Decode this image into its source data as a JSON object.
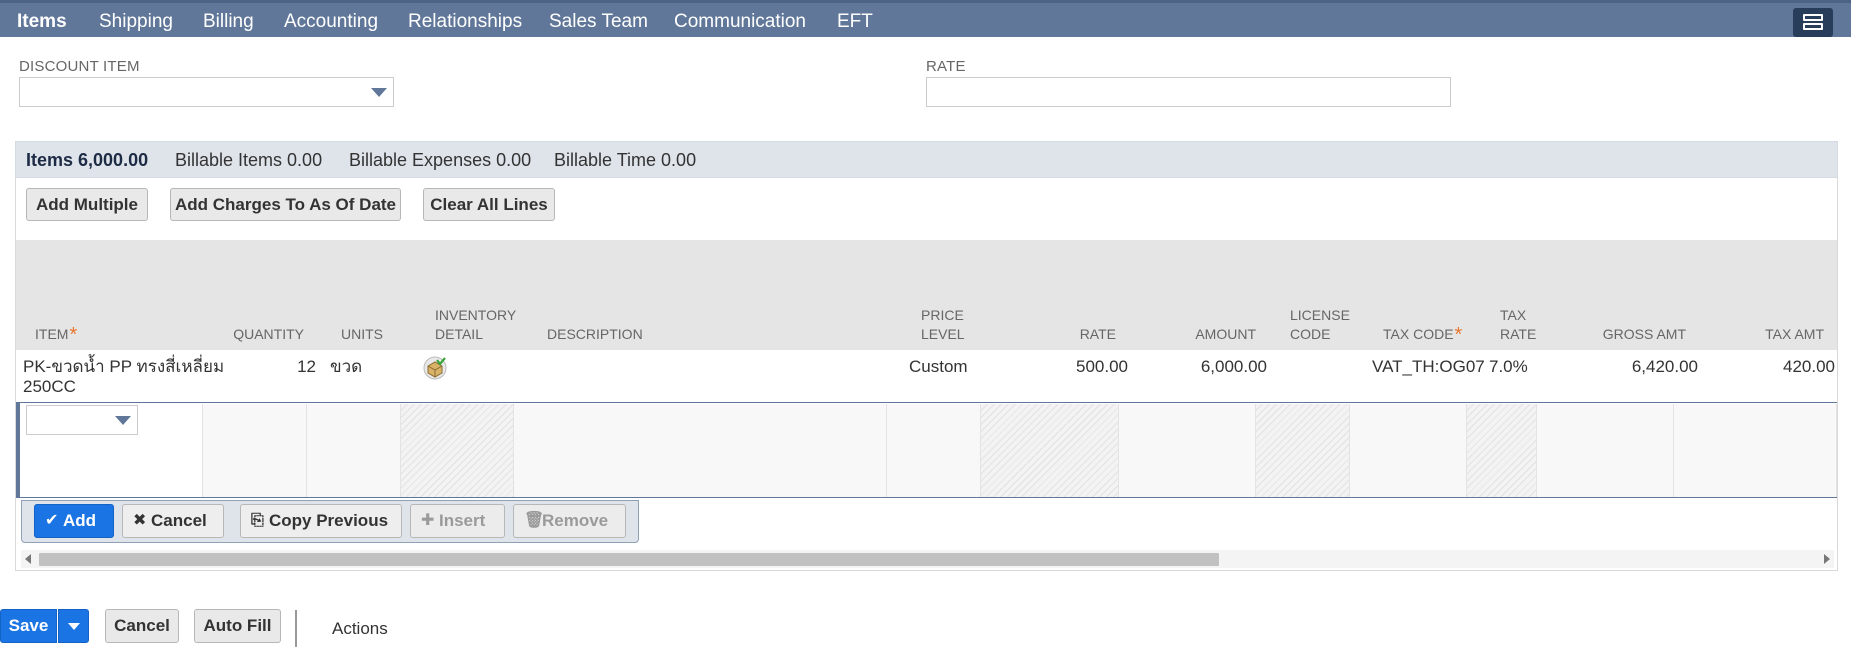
{
  "tabs": [
    {
      "label": "Items",
      "active": true
    },
    {
      "label": "Shipping",
      "active": false
    },
    {
      "label": "Billing",
      "active": false
    },
    {
      "label": "Accounting",
      "active": false
    },
    {
      "label": "Relationships",
      "active": false
    },
    {
      "label": "Sales Team",
      "active": false
    },
    {
      "label": "Communication",
      "active": false
    },
    {
      "label": "EFT",
      "active": false
    }
  ],
  "fields": {
    "discount_item": {
      "label": "DISCOUNT ITEM",
      "value": ""
    },
    "rate": {
      "label": "RATE",
      "value": ""
    }
  },
  "subtabs": [
    {
      "label": "Items 6,000.00",
      "active": true
    },
    {
      "label": "Billable Items 0.00",
      "active": false
    },
    {
      "label": "Billable Expenses 0.00",
      "active": false
    },
    {
      "label": "Billable Time 0.00",
      "active": false
    }
  ],
  "list_buttons": {
    "add_multiple": "Add Multiple",
    "add_charges": "Add Charges To As Of Date",
    "clear_all": "Clear All Lines"
  },
  "columns": {
    "item": "ITEM",
    "quantity": "QUANTITY",
    "units": "UNITS",
    "inventory_detail_1": "INVENTORY",
    "inventory_detail_2": "DETAIL",
    "description": "DESCRIPTION",
    "price_level_1": "PRICE",
    "price_level_2": "LEVEL",
    "rate": "RATE",
    "amount": "AMOUNT",
    "license_code_1": "LICENSE",
    "license_code_2": "CODE",
    "tax_code": "TAX CODE",
    "tax_rate_1": "TAX",
    "tax_rate_2": "RATE",
    "gross_amt": "GROSS AMT",
    "tax_amt": "TAX AMT"
  },
  "rows": [
    {
      "item_line1": "PK-ขวดน้ำ PP ทรงสี่เหลี่ยม",
      "item_line2": "250CC",
      "quantity": "12",
      "units": "ขวด",
      "inventory_detail_icon": "inventory-box-icon",
      "description": "",
      "price_level": "Custom",
      "rate": "500.00",
      "amount": "6,000.00",
      "license_code": "",
      "tax_code": "VAT_TH:OG07",
      "tax_rate": "7.0%",
      "gross_amt": "6,420.00",
      "tax_amt": "420.00"
    }
  ],
  "line_actions": {
    "add": "Add",
    "cancel": "Cancel",
    "copy_previous": "Copy Previous",
    "insert": "Insert",
    "remove": "Remove"
  },
  "footer": {
    "save": "Save",
    "cancel": "Cancel",
    "auto_fill": "Auto Fill",
    "actions": "Actions"
  },
  "colors": {
    "tab_bar": "#607799",
    "primary_button": "#1b74e4",
    "required_marker": "#e8772e"
  }
}
